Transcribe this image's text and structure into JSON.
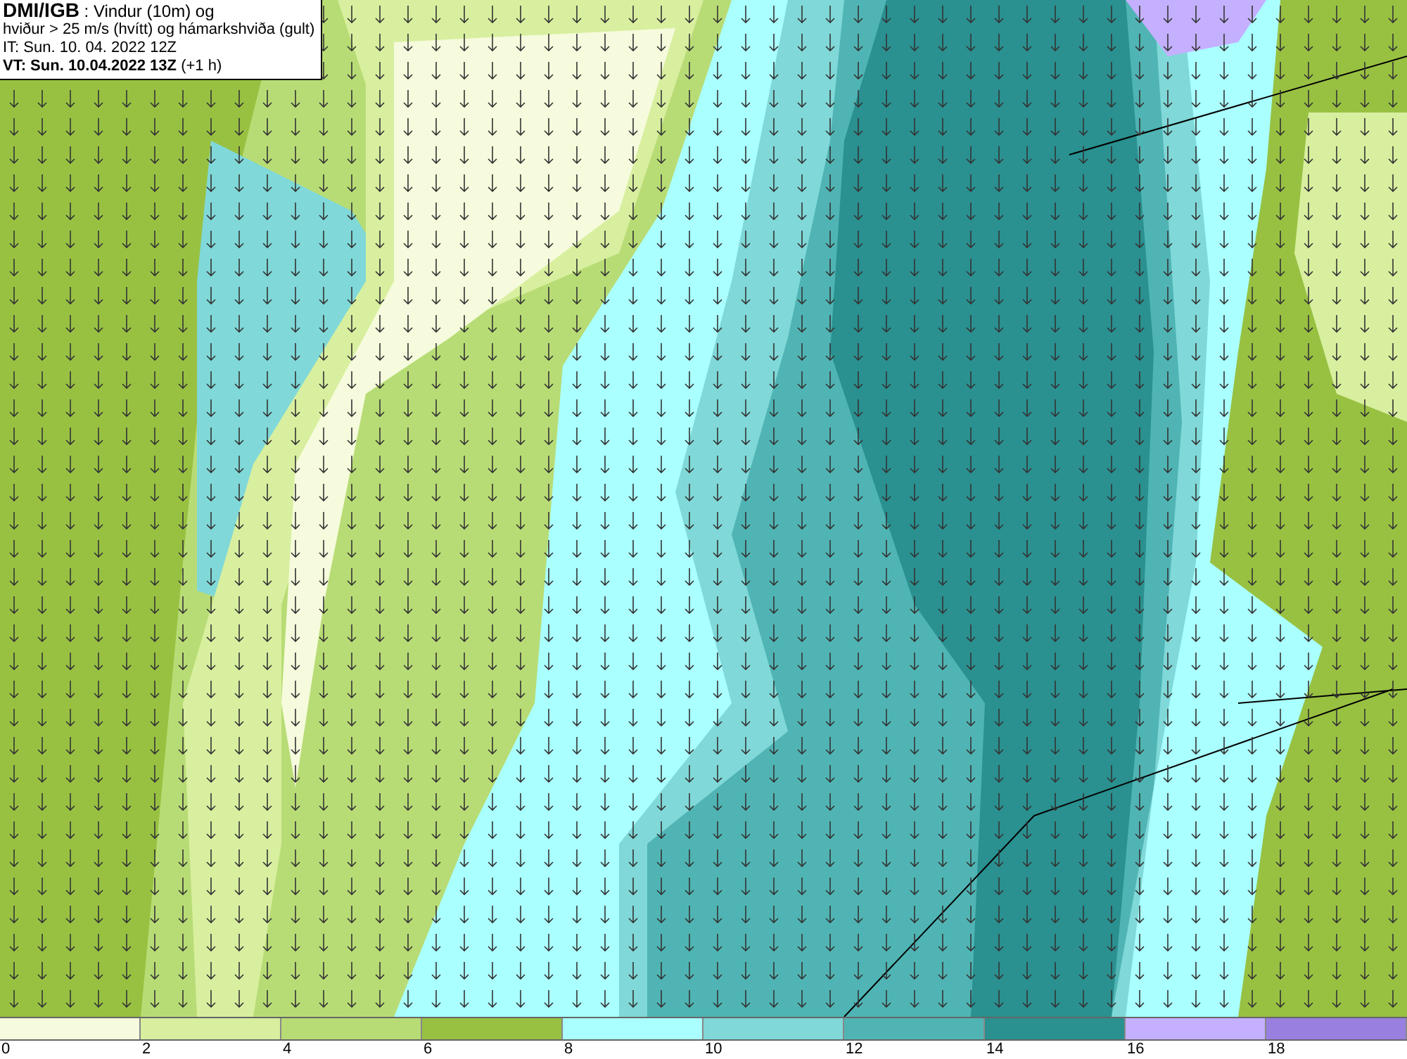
{
  "header": {
    "lines": [
      "**DMI/IGB** : Vindur (10m) og",
      "hviður > 25 m/s (hvítt) og hámarkshviða (gult)",
      "IT: Sun. 10. 04. 2022 12Z",
      "**VT: Sun. 10.04.2022 13Z** (+1 h)"
    ]
  },
  "legend": {
    "bins": [
      {
        "color": "#f5fbdc"
      },
      {
        "color": "#d8ef9f"
      },
      {
        "color": "#b8dc75"
      },
      {
        "color": "#98c142"
      },
      {
        "color": "#aaffff"
      },
      {
        "color": "#80d8d8"
      },
      {
        "color": "#50b4b4"
      },
      {
        "color": "#2a9090"
      },
      {
        "color": "#c4b0ff"
      },
      {
        "color": "#9980e0"
      }
    ],
    "ticks": [
      "0",
      "2",
      "4",
      "6",
      "8",
      "10",
      "12",
      "14",
      "16",
      "18"
    ]
  }
}
